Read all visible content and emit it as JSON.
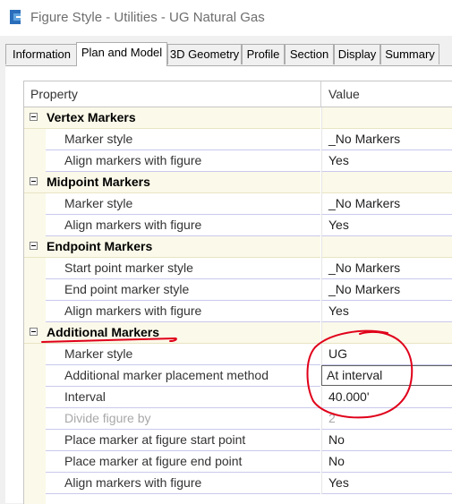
{
  "window": {
    "title": "Figure Style - Utilities - UG Natural Gas",
    "icon": "civil3d-app-icon"
  },
  "tabs": [
    {
      "label": "Information",
      "active": false
    },
    {
      "label": "Plan and Model",
      "active": true
    },
    {
      "label": "3D Geometry",
      "active": false
    },
    {
      "label": "Profile",
      "active": false
    },
    {
      "label": "Section",
      "active": false
    },
    {
      "label": "Display",
      "active": false
    },
    {
      "label": "Summary",
      "active": false
    }
  ],
  "grid": {
    "header": {
      "property": "Property",
      "value": "Value"
    },
    "categories": [
      {
        "name": "Vertex Markers",
        "rows": [
          {
            "property": "Marker style",
            "value": "_No Markers"
          },
          {
            "property": "Align markers with figure",
            "value": "Yes"
          }
        ]
      },
      {
        "name": "Midpoint Markers",
        "rows": [
          {
            "property": "Marker style",
            "value": "_No Markers"
          },
          {
            "property": "Align markers with figure",
            "value": "Yes"
          }
        ]
      },
      {
        "name": "Endpoint Markers",
        "rows": [
          {
            "property": "Start point marker style",
            "value": "_No Markers"
          },
          {
            "property": "End point marker style",
            "value": "_No Markers"
          },
          {
            "property": "Align markers with figure",
            "value": "Yes"
          }
        ]
      },
      {
        "name": "Additional Markers",
        "rows": [
          {
            "property": "Marker style",
            "value": "UG"
          },
          {
            "property": "Additional marker placement method",
            "value": "At interval"
          },
          {
            "property": "Interval",
            "value": "40.000'"
          },
          {
            "property": "Divide figure by",
            "value": "2"
          },
          {
            "property": "Place marker at figure start point",
            "value": "No"
          },
          {
            "property": "Place marker at figure end point",
            "value": "No"
          },
          {
            "property": "Align markers with figure",
            "value": "Yes"
          }
        ]
      }
    ]
  },
  "annotation_color": "#e0001a"
}
